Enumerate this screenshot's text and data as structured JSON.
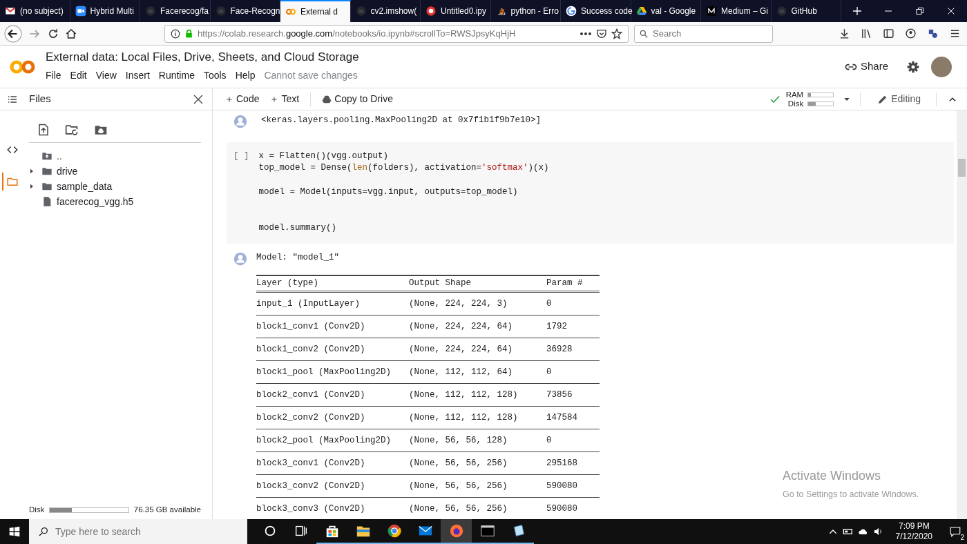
{
  "browser_tabs": [
    {
      "title": "(no subject)",
      "kind": "mail",
      "selected": false
    },
    {
      "title": "Hybrid Multi",
      "kind": "video",
      "selected": false
    },
    {
      "title": "Facerecog/fa",
      "kind": "octocat",
      "selected": false
    },
    {
      "title": "Face-Recogn",
      "kind": "octocat",
      "selected": false
    },
    {
      "title": "External d",
      "kind": "colab",
      "selected": true
    },
    {
      "title": "cv2.imshow(",
      "kind": "octocat",
      "selected": false
    },
    {
      "title": "Untitled0.ipy",
      "kind": "ring",
      "selected": false
    },
    {
      "title": "python - Erro",
      "kind": "stack",
      "selected": false
    },
    {
      "title": "Success code",
      "kind": "google",
      "selected": false
    },
    {
      "title": "val - Google",
      "kind": "drive",
      "selected": false
    },
    {
      "title": "Medium – Gi",
      "kind": "medium",
      "selected": false
    },
    {
      "title": "GitHub",
      "kind": "octocat",
      "selected": false
    }
  ],
  "address_bar": {
    "url": "https://colab.research.**google.com**/notebooks/io.ipynb#scrollTo=RWSJpsyKqHjH"
  },
  "browser_search": {
    "placeholder": "Search"
  },
  "notebook": {
    "title": "External data: Local Files, Drive, Sheets, and Cloud Storage",
    "menu": [
      "File",
      "Edit",
      "View",
      "Insert",
      "Runtime",
      "Tools",
      "Help"
    ],
    "save_status": "Cannot save changes",
    "share": "Share"
  },
  "toolbar": {
    "add_code": "Code",
    "add_text": "Text",
    "copy": "Copy to Drive",
    "connected": true,
    "meters": [
      {
        "label": "RAM",
        "level": 0.1
      },
      {
        "label": "Disk",
        "level": 0.3
      }
    ],
    "mode": "Editing"
  },
  "sidebar": {
    "title": "Files",
    "rail": [
      {
        "kind": "snippets",
        "selected": false
      },
      {
        "kind": "files",
        "selected": true
      }
    ],
    "files": [
      {
        "name": "..",
        "kind": "parent"
      },
      {
        "name": "drive",
        "kind": "folder",
        "expanded": false
      },
      {
        "name": "sample_data",
        "kind": "folder",
        "expanded": false
      },
      {
        "name": "facerecog_vgg.h5",
        "kind": "file"
      }
    ],
    "disk": {
      "label": "Disk",
      "level": 0.28,
      "available": "76.35 GB available"
    }
  },
  "cells": [
    {
      "kind": "output",
      "lines": [
        "<keras.layers.pooling.MaxPooling2D at 0x7f1b1f9b7e10>]"
      ]
    },
    {
      "kind": "code",
      "prompt": "[ ]",
      "lines": [
        {
          "kind": "code",
          "segments": [
            {
              "kind": "plain",
              "text": "x = Flatten()(vgg.output)"
            }
          ]
        },
        {
          "kind": "code",
          "segments": [
            {
              "kind": "plain",
              "text": "top_model = Dense("
            },
            {
              "kind": "builtin",
              "text": "len"
            },
            {
              "kind": "plain",
              "text": "(folders), activation="
            },
            {
              "kind": "string",
              "text": "'softmax'"
            },
            {
              "kind": "plain",
              "text": ")(x)"
            }
          ]
        },
        {
          "kind": "blank"
        },
        {
          "kind": "code",
          "segments": [
            {
              "kind": "plain",
              "text": "model = Model(inputs=vgg.input, outputs=top_model)"
            }
          ]
        },
        {
          "kind": "blank"
        },
        {
          "kind": "blank"
        },
        {
          "kind": "code",
          "segments": [
            {
              "kind": "plain",
              "text": "model.summary()"
            }
          ]
        }
      ]
    },
    {
      "kind": "summary",
      "heading": "Model: \"model_1\"",
      "columns": [
        "Layer (type)",
        "Output Shape",
        "Param #"
      ],
      "rows": [
        [
          "input_1 (InputLayer)",
          "(None, 224, 224, 3)",
          "0"
        ],
        [
          "block1_conv1 (Conv2D)",
          "(None, 224, 224, 64)",
          "1792"
        ],
        [
          "block1_conv2 (Conv2D)",
          "(None, 224, 224, 64)",
          "36928"
        ],
        [
          "block1_pool (MaxPooling2D)",
          "(None, 112, 112, 64)",
          "0"
        ],
        [
          "block2_conv1 (Conv2D)",
          "(None, 112, 112, 128)",
          "73856"
        ],
        [
          "block2_conv2 (Conv2D)",
          "(None, 112, 112, 128)",
          "147584"
        ],
        [
          "block2_pool (MaxPooling2D)",
          "(None, 56, 56, 128)",
          "0"
        ],
        [
          "block3_conv1 (Conv2D)",
          "(None, 56, 56, 256)",
          "295168"
        ],
        [
          "block3_conv2 (Conv2D)",
          "(None, 56, 56, 256)",
          "590080"
        ],
        [
          "block3_conv3 (Conv2D)",
          "(None, 56, 56, 256)",
          "590080"
        ]
      ]
    }
  ],
  "windows_notice": {
    "title": "Activate Windows",
    "subtitle": "Go to Settings to activate Windows."
  },
  "taskbar": {
    "search_placeholder": "Type here to search",
    "apps": [
      {
        "kind": "cortana",
        "running": false,
        "selected": false
      },
      {
        "kind": "taskview",
        "running": false,
        "selected": false
      },
      {
        "kind": "store",
        "running": true,
        "selected": false
      },
      {
        "kind": "explorer",
        "running": true,
        "selected": false
      },
      {
        "kind": "chrome",
        "running": true,
        "selected": false
      },
      {
        "kind": "mail",
        "running": true,
        "selected": false
      },
      {
        "kind": "firefox",
        "running": true,
        "selected": true
      },
      {
        "kind": "terminal",
        "running": true,
        "selected": false
      },
      {
        "kind": "notepad",
        "running": true,
        "selected": false
      }
    ],
    "time": "7:09 PM",
    "date": "7/12/2020",
    "notifications": "2"
  }
}
